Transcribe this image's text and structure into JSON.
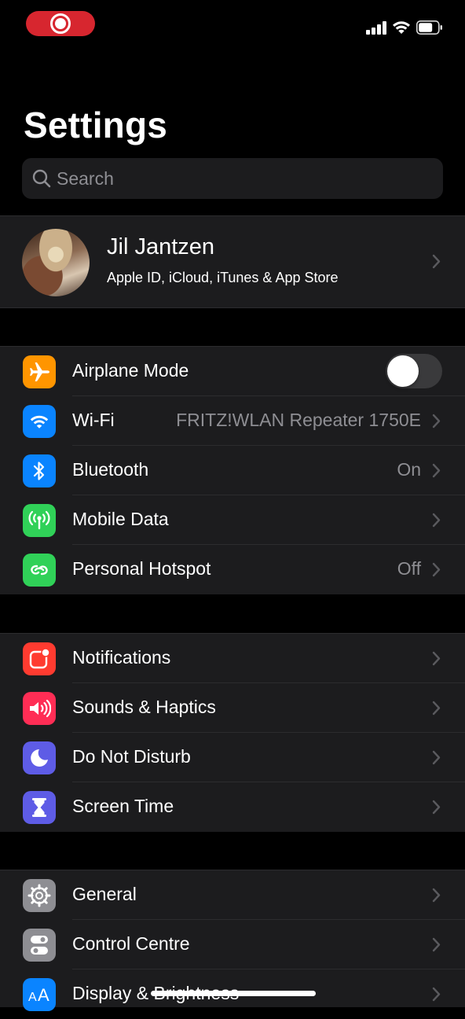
{
  "status_bar": {
    "recording_indicator": "screen-recording",
    "icons": [
      "signal-icon",
      "wifi-icon",
      "battery-icon"
    ]
  },
  "title": "Settings",
  "search": {
    "placeholder": "Search"
  },
  "profile": {
    "name": "Jil Jantzen",
    "subtitle": "Apple ID, iCloud, iTunes & App Store"
  },
  "connectivity": {
    "airplane_mode": {
      "label": "Airplane Mode",
      "toggle_on": false,
      "icon_color": "#ff9500"
    },
    "wifi": {
      "label": "Wi-Fi",
      "value": "FRITZ!WLAN Repeater 1750E",
      "icon_color": "#0a84ff"
    },
    "bluetooth": {
      "label": "Bluetooth",
      "value": "On",
      "icon_color": "#0a84ff"
    },
    "mobile_data": {
      "label": "Mobile Data",
      "icon_color": "#30d158"
    },
    "personal_hotspot": {
      "label": "Personal Hotspot",
      "value": "Off",
      "icon_color": "#30d158"
    }
  },
  "alerts": {
    "notifications": {
      "label": "Notifications",
      "icon_color": "#ff3b30"
    },
    "sounds": {
      "label": "Sounds & Haptics",
      "icon_color": "#ff2d55"
    },
    "dnd": {
      "label": "Do Not Disturb",
      "icon_color": "#5e5ce6"
    },
    "screen_time": {
      "label": "Screen Time",
      "icon_color": "#5e5ce6"
    }
  },
  "system": {
    "general": {
      "label": "General",
      "icon_color": "#8e8e93"
    },
    "control_centre": {
      "label": "Control Centre",
      "icon_color": "#8e8e93"
    },
    "display": {
      "label": "Display & Brightness",
      "icon_color": "#0a84ff"
    }
  }
}
